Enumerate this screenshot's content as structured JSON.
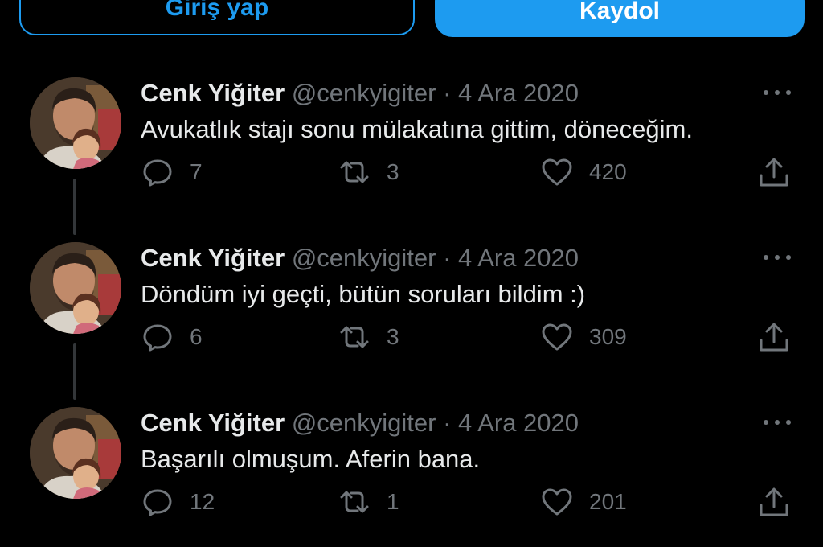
{
  "auth": {
    "login_label": "Giriş yap",
    "signup_label": "Kaydol"
  },
  "colors": {
    "accent": "#1d9bf0",
    "muted": "#71767b",
    "text": "#e7e9ea",
    "background": "#000000"
  },
  "tweets": [
    {
      "name": "Cenk Yiğiter",
      "handle": "@cenkyigiter",
      "separator": "·",
      "date": "4 Ara 2020",
      "text": "Avukatlık stajı sonu mülakatına gittim, döneceğim.",
      "replies": "7",
      "retweets": "3",
      "likes": "420"
    },
    {
      "name": "Cenk Yiğiter",
      "handle": "@cenkyigiter",
      "separator": "·",
      "date": "4 Ara 2020",
      "text": "Döndüm iyi geçti, bütün soruları bildim :)",
      "replies": "6",
      "retweets": "3",
      "likes": "309"
    },
    {
      "name": "Cenk Yiğiter",
      "handle": "@cenkyigiter",
      "separator": "·",
      "date": "4 Ara 2020",
      "text": "Başarılı olmuşum. Aferin bana.",
      "replies": "12",
      "retweets": "1",
      "likes": "201"
    }
  ],
  "icons": {
    "more": "more-horizontal-icon",
    "reply": "reply-bubble-icon",
    "retweet": "retweet-icon",
    "like": "heart-icon",
    "share": "share-upload-icon"
  }
}
